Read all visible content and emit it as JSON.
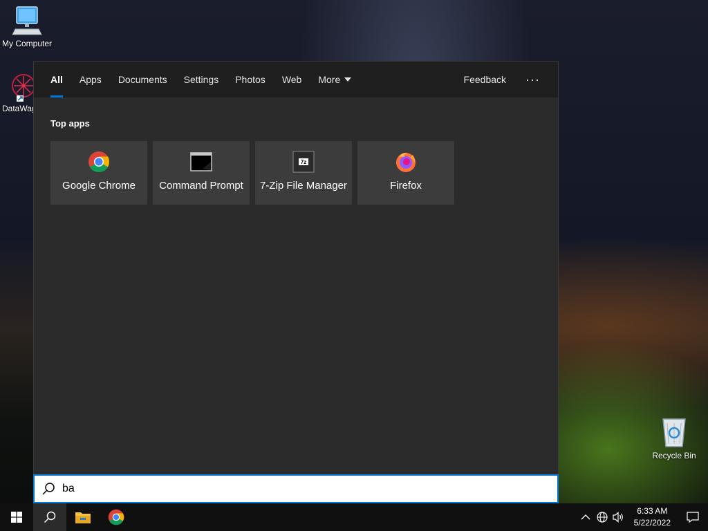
{
  "desktop": {
    "icons": [
      {
        "label": "My Computer"
      },
      {
        "label": "DataWag"
      },
      {
        "label": "Recycle Bin"
      }
    ]
  },
  "search": {
    "tabs": [
      "All",
      "Apps",
      "Documents",
      "Settings",
      "Photos",
      "Web",
      "More"
    ],
    "active_tab": "All",
    "feedback_label": "Feedback",
    "options_label": "···",
    "section_title": "Top apps",
    "top_apps": [
      {
        "label": "Google Chrome",
        "icon": "chrome-icon"
      },
      {
        "label": "Command Prompt",
        "icon": "command-prompt-icon"
      },
      {
        "label": "7-Zip File Manager",
        "icon": "7zip-icon"
      },
      {
        "label": "Firefox",
        "icon": "firefox-icon"
      }
    ],
    "query": "ba",
    "zip_badge": "7z"
  },
  "taskbar": {
    "time": "6:33 AM",
    "date": "5/22/2022",
    "tray_chevron": "^"
  },
  "colors": {
    "accent": "#0078d7",
    "panel_bg": "#2b2b2b",
    "tabs_bg": "#1f1f1f",
    "tile_bg": "#3c3c3c"
  }
}
